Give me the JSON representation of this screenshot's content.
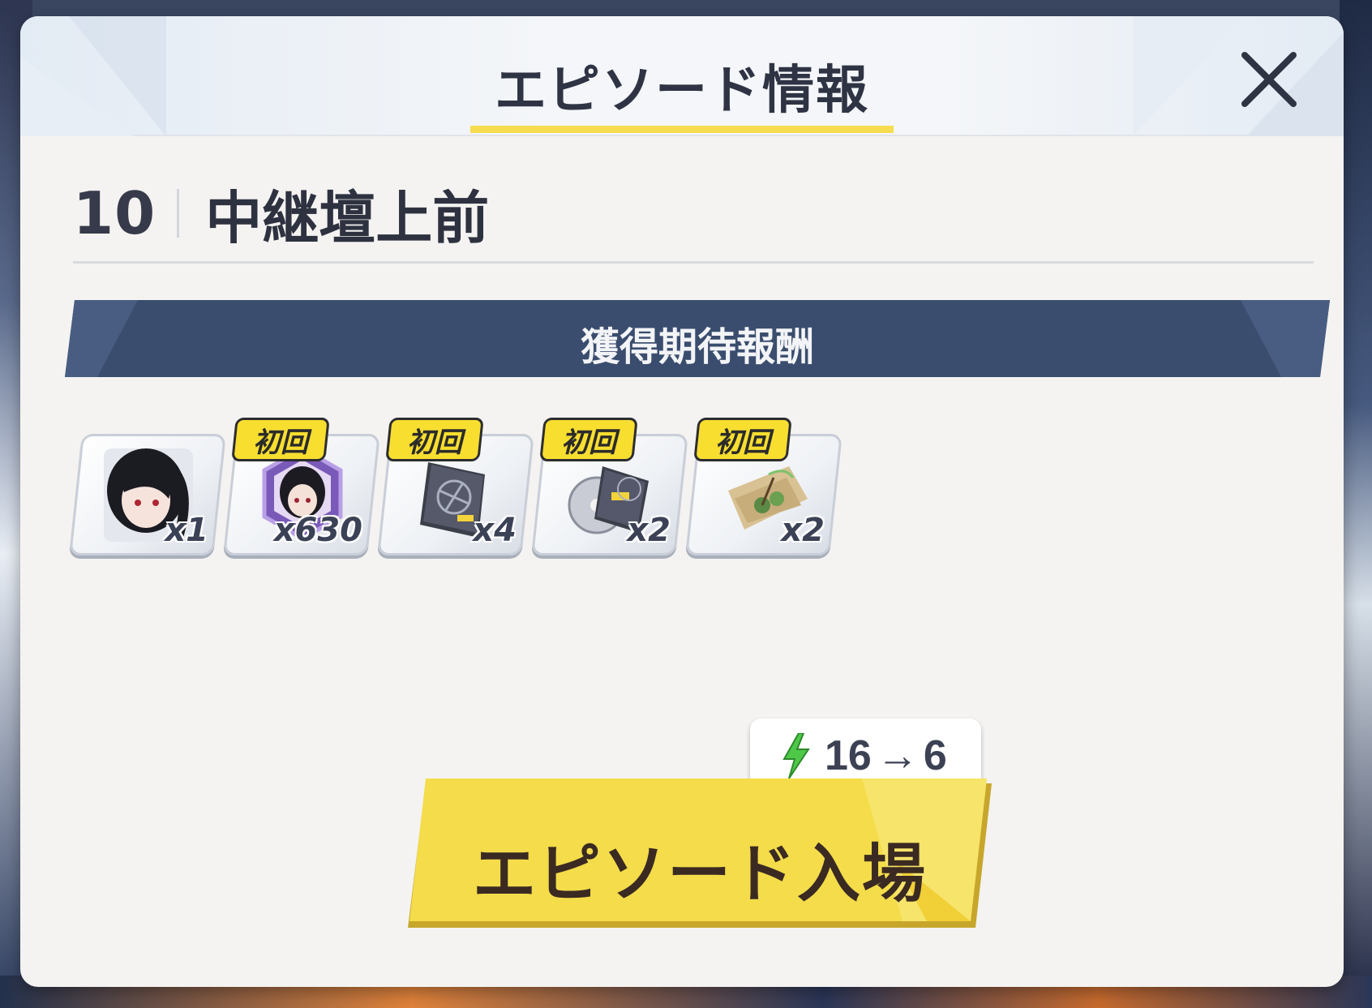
{
  "header": {
    "title": "エピソード情報"
  },
  "episode": {
    "number": "10",
    "name": "中継壇上前"
  },
  "rewards": {
    "label": "獲得期待報酬",
    "first_clear_badge": "初回",
    "items": [
      {
        "icon": "character-portrait-icon",
        "quantity": "x1",
        "first_clear": false
      },
      {
        "icon": "character-eleph-icon",
        "quantity": "x630",
        "first_clear": true
      },
      {
        "icon": "skill-book-icon",
        "quantity": "x4",
        "first_clear": true
      },
      {
        "icon": "ex-skill-disc-icon",
        "quantity": "x2",
        "first_clear": true
      },
      {
        "icon": "ancient-scroll-icon",
        "quantity": "x2",
        "first_clear": true
      }
    ]
  },
  "cost": {
    "icon": "energy-lightning-icon",
    "from": "16",
    "to": "6",
    "arrow": "→"
  },
  "enter_button": {
    "label": "エピソード入場"
  },
  "colors": {
    "accent_yellow": "#f6dc4f",
    "banner_navy": "#3a4d6e",
    "button_yellow": "#f4dc4a",
    "energy_green": "#4fc84a"
  }
}
